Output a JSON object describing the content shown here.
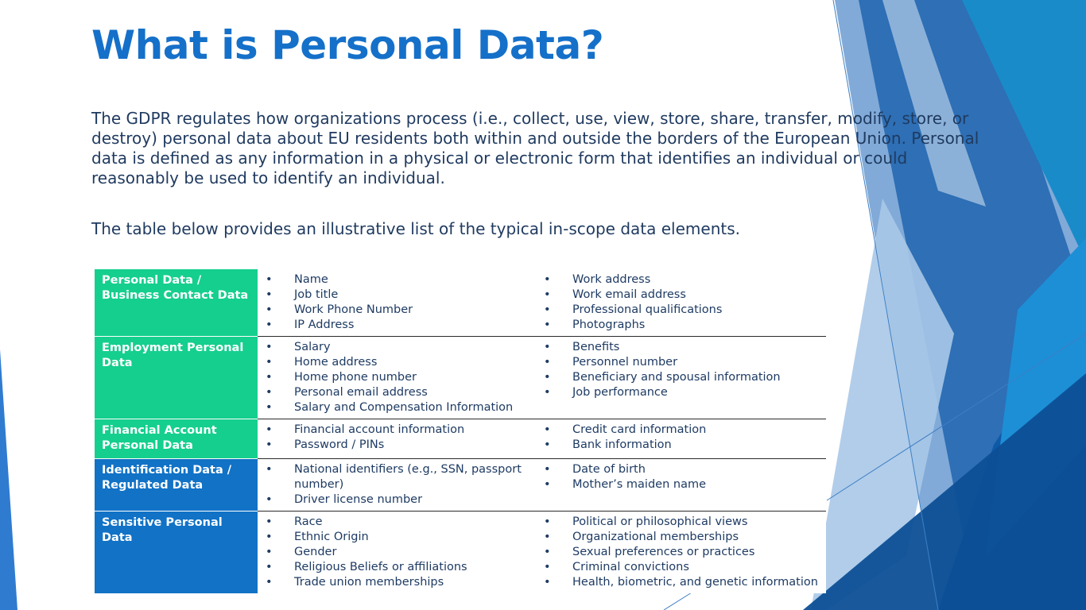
{
  "slide": {
    "title": "What is Personal Data?",
    "paragraph1": "The GDPR regulates how organizations process (i.e., collect, use, view, store, share, transfer, modify, store, or destroy) personal data about EU residents both within and outside the borders of the European Union. Personal data is defined as any information in a physical or electronic form that identifies an individual or could reasonably be used to identify an individual.",
    "paragraph2": "The table below provides an illustrative list of the typical in-scope data elements."
  },
  "colors": {
    "title": "#1570c9",
    "body_text": "#1f3a5f",
    "category_green": "#15cf8e",
    "category_blue": "#1172c6"
  },
  "table": {
    "rows": [
      {
        "category": "Personal Data / Business Contact Data",
        "left": [
          "Name",
          "Job title",
          "Work Phone Number",
          "IP Address"
        ],
        "right": [
          "Work address",
          "Work email address",
          "Professional qualifications",
          "Photographs"
        ]
      },
      {
        "category": "Employment Personal Data",
        "left": [
          "Salary",
          "Home address",
          "Home phone number",
          "Personal email address",
          "Salary and Compensation Information"
        ],
        "right": [
          "Benefits",
          "Personnel number",
          "Beneficiary and spousal information",
          "Job performance"
        ]
      },
      {
        "category": "Financial Account Personal Data",
        "left": [
          "Financial account information",
          "Password / PINs"
        ],
        "right": [
          "Credit card information",
          "Bank information"
        ]
      },
      {
        "category": "Identification Data / Regulated Data",
        "left": [
          "National identifiers (e.g., SSN, passport number)",
          "Driver license number"
        ],
        "right": [
          "Date of birth",
          "Mother’s maiden name"
        ]
      },
      {
        "category": "Sensitive Personal Data",
        "left": [
          "Race",
          "Ethnic Origin",
          "Gender",
          "Religious Beliefs or affiliations",
          "Trade union memberships"
        ],
        "right": [
          "Political or philosophical views",
          "Organizational memberships",
          "Sexual preferences or practices",
          "Criminal convictions",
          "Health, biometric, and genetic information"
        ]
      }
    ]
  }
}
